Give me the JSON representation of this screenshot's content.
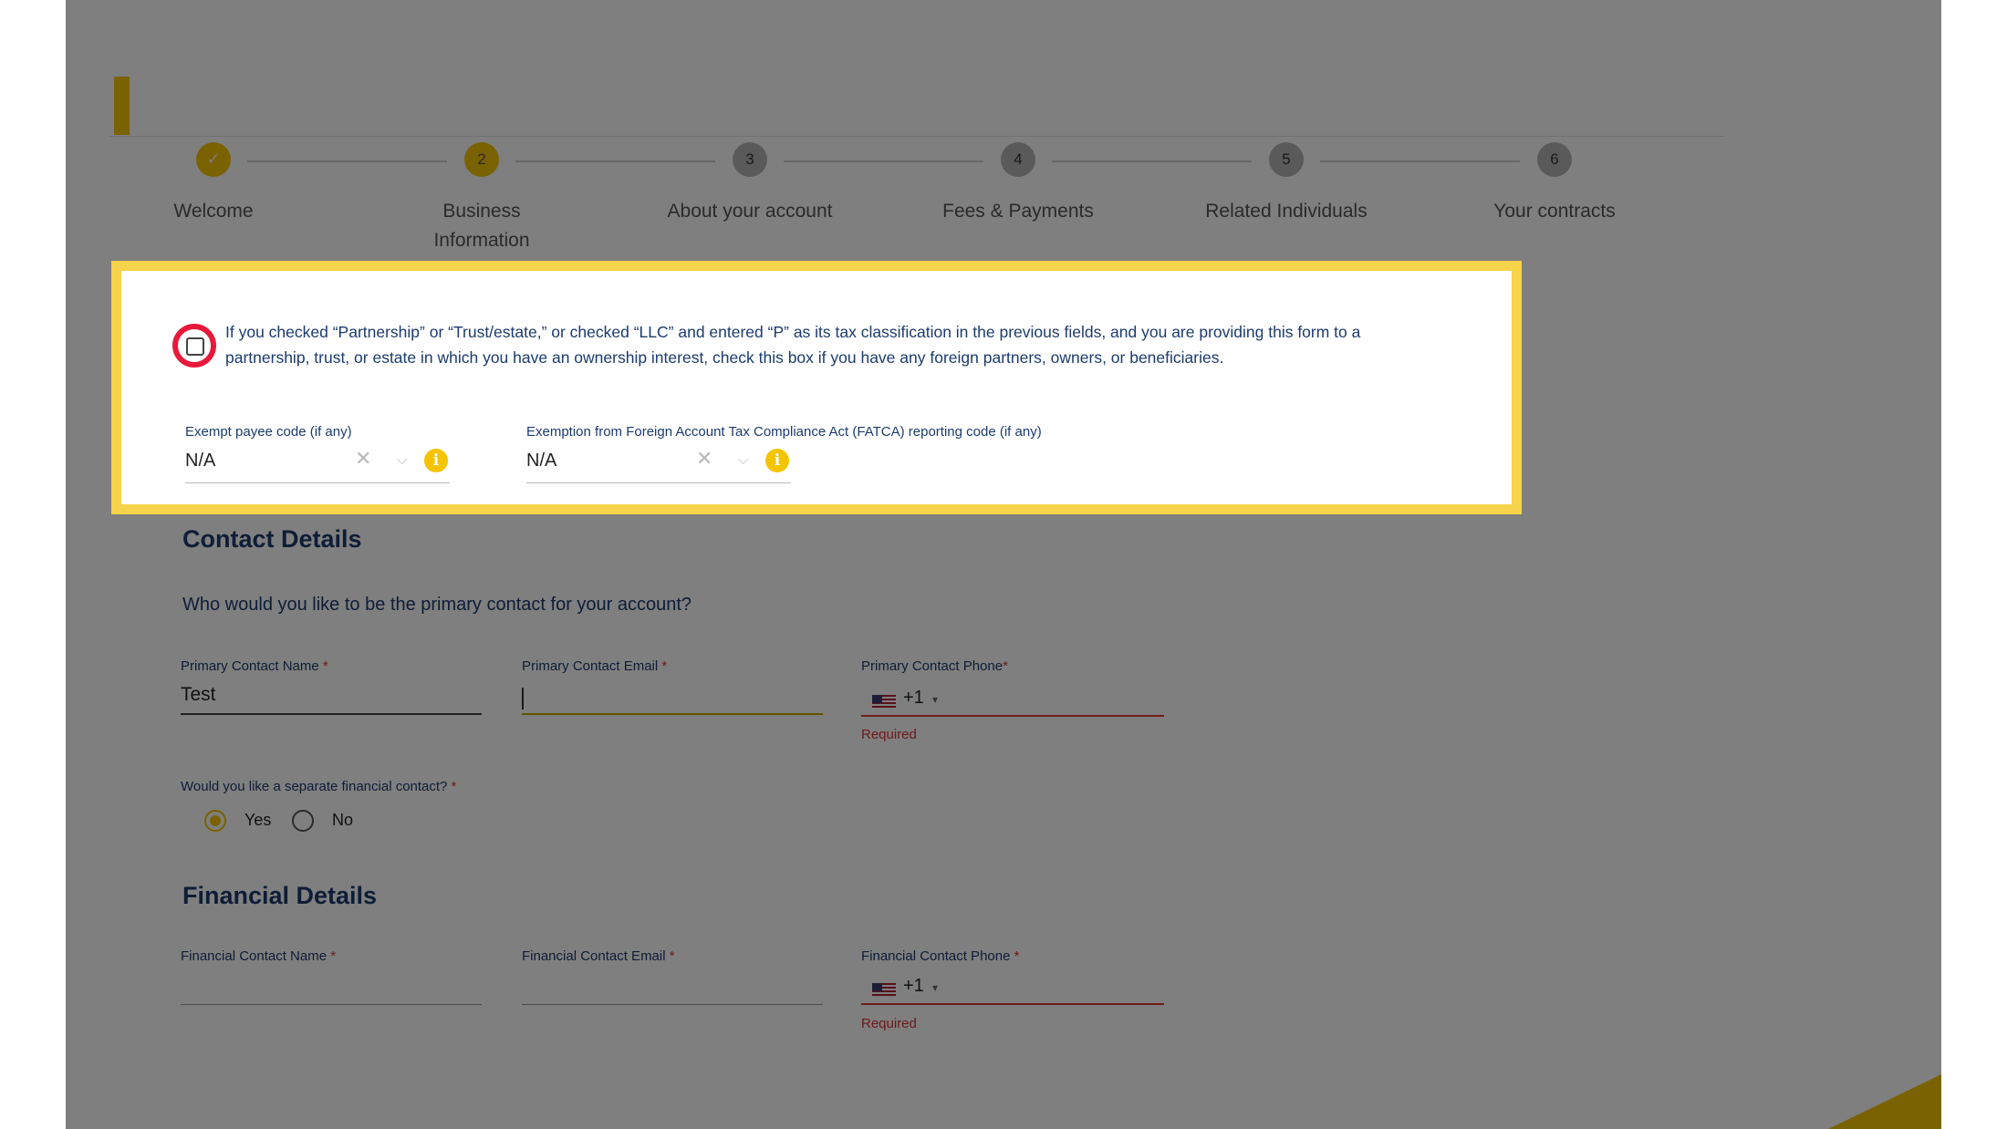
{
  "stepper": {
    "steps": [
      {
        "number": "✓",
        "label": "Welcome",
        "state": "done"
      },
      {
        "number": "2",
        "label": "Business Information",
        "state": "active"
      },
      {
        "number": "3",
        "label": "About your account",
        "state": "pending"
      },
      {
        "number": "4",
        "label": "Fees & Payments",
        "state": "pending"
      },
      {
        "number": "5",
        "label": "Related Individuals",
        "state": "pending"
      },
      {
        "number": "6",
        "label": "Your contracts",
        "state": "pending"
      }
    ]
  },
  "tax_section": {
    "foreign_partners_checkbox_text": "If you checked “Partnership” or “Trust/estate,” or checked “LLC” and entered “P” as its tax classification in the previous fields, and you are providing this form to a partnership, trust, or estate in which you have an ownership interest, check this box if you have any foreign partners, owners, or beneficiaries.",
    "foreign_partners_checked": false,
    "exempt_payee": {
      "label": "Exempt payee code (if any)",
      "value": "N/A"
    },
    "fatca": {
      "label": "Exemption from Foreign Account Tax Compliance Act (FATCA) reporting code (if any)",
      "value": "N/A"
    }
  },
  "contact_details": {
    "title": "Contact Details",
    "question": "Who would you like to be the primary contact for your account?",
    "name": {
      "label": "Primary Contact Name",
      "value": "Test"
    },
    "email": {
      "label": "Primary Contact Email",
      "value": ""
    },
    "phone": {
      "label": "Primary Contact Phone",
      "dial_code": "+1",
      "error": "Required"
    },
    "required_marker": "*",
    "separate_financial": {
      "label": "Would you like a separate financial contact?",
      "options": [
        "Yes",
        "No"
      ],
      "selected": "Yes"
    }
  },
  "financial_details": {
    "title": "Financial Details",
    "name": {
      "label": "Financial Contact Name",
      "value": ""
    },
    "email": {
      "label": "Financial Contact Email",
      "value": ""
    },
    "phone": {
      "label": "Financial Contact Phone",
      "dial_code": "+1",
      "error": "Required"
    }
  },
  "icons": {
    "clear": "✕",
    "dropdown": "⌵",
    "info": "i",
    "caret": "▾"
  },
  "colors": {
    "accent": "#f5c400",
    "highlight_frame": "#f5d34a",
    "annotation_ring": "#e8183a",
    "heading": "#1c3b6e",
    "error": "#d33333"
  }
}
